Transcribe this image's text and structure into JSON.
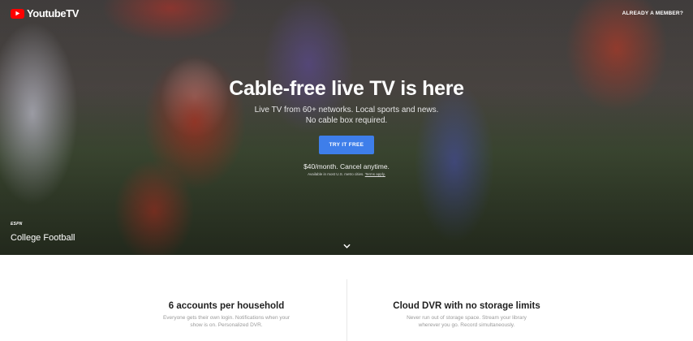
{
  "header": {
    "logo_text": "YoutubeTV",
    "member_link": "ALREADY A MEMBER?"
  },
  "hero": {
    "title": "Cable-free live TV is here",
    "subtitle_line1": "Live TV from 60+ networks. Local sports and news.",
    "subtitle_line2": "No cable box required.",
    "cta_label": "TRY IT FREE",
    "price": "$40/month. Cancel anytime.",
    "fine_print": "Available in most U.S. metro cities.",
    "terms_link": "Terms apply.",
    "network_badge": "ESPN",
    "program_title": "College Football",
    "scroll_icon": "chevron-down-icon"
  },
  "features": [
    {
      "title": "6 accounts per household",
      "desc_line1": "Everyone gets their own login. Notifications when your",
      "desc_line2": "show is on. Personalized DVR."
    },
    {
      "title": "Cloud DVR with no storage limits",
      "desc_line1": "Never run out of storage space. Stream your library",
      "desc_line2": "wherever you go. Record simultaneously."
    }
  ],
  "colors": {
    "brand_red": "#ff0000",
    "cta_blue": "#3e7eea"
  }
}
